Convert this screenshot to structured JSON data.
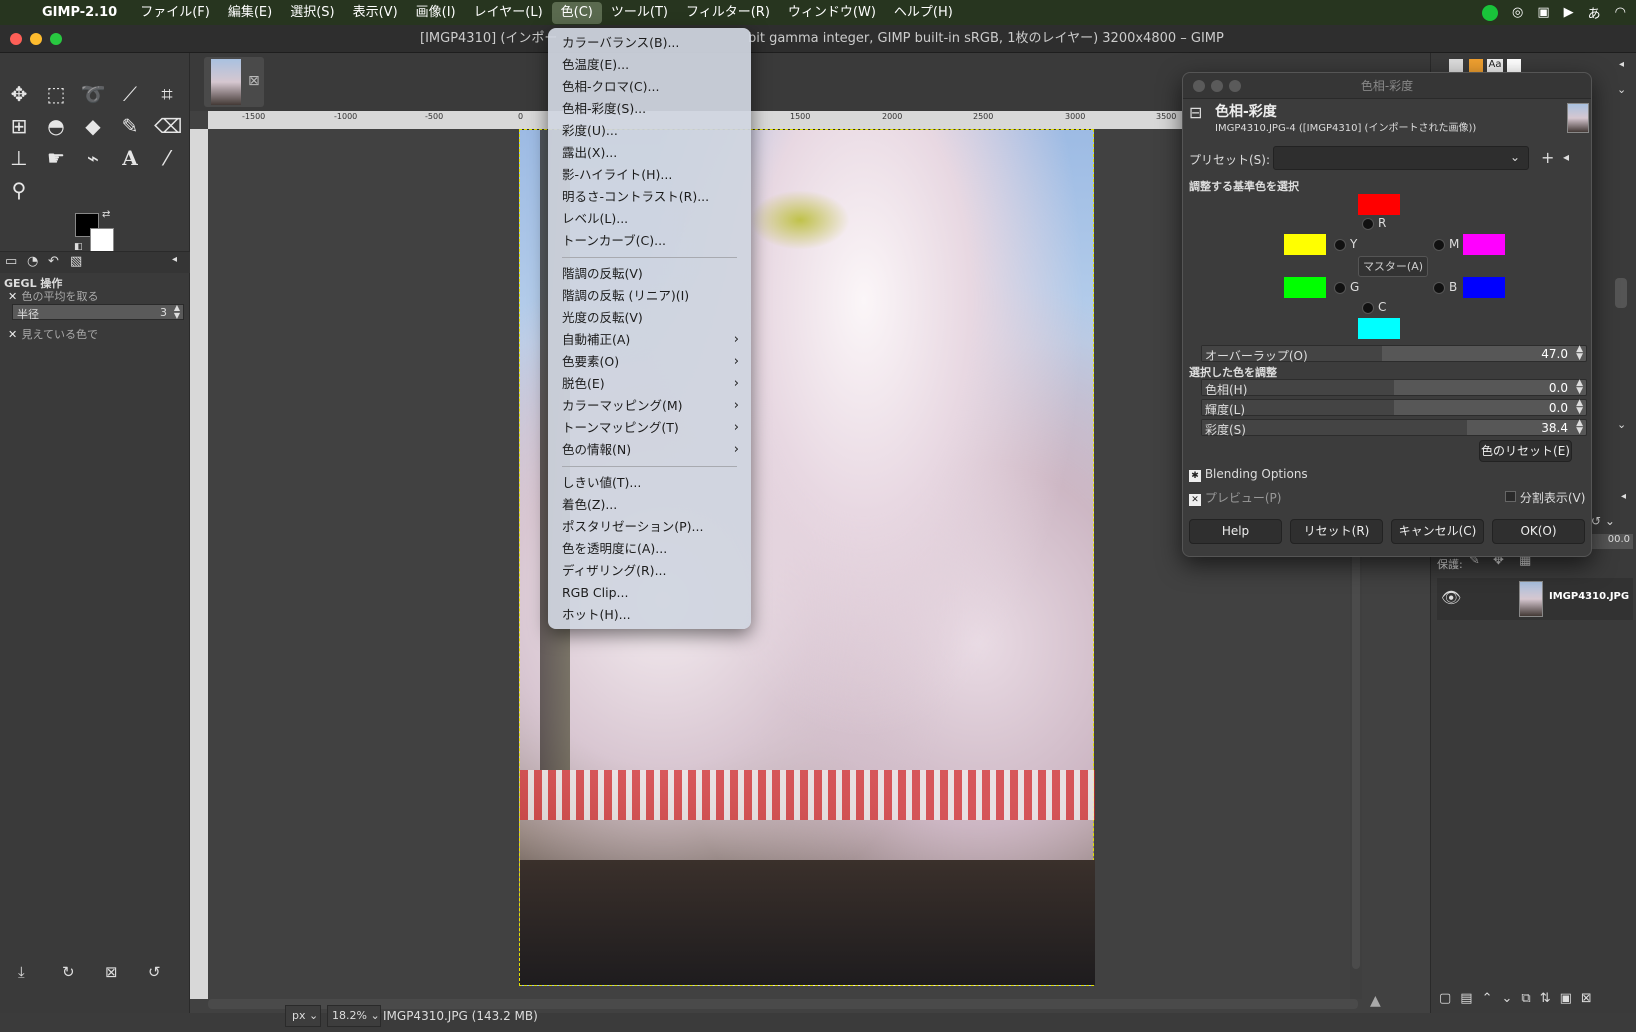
{
  "menubar": {
    "app": "GIMP-2.10",
    "items": [
      "ファイル(F)",
      "編集(E)",
      "選択(S)",
      "表示(V)",
      "画像(I)",
      "レイヤー(L)",
      "色(C)",
      "ツール(T)",
      "フィルター(R)",
      "ウィンドウ(W)",
      "ヘルプ(H)"
    ],
    "active_index": 6
  },
  "window": {
    "title_left": "[IMGP4310] (インポー",
    "title_right": "bit gamma integer, GIMP built-in sRGB, 1枚のレイヤー) 3200x4800 – GIMP"
  },
  "toolbox": {
    "dock_title": "GEGL 操作",
    "option1": "色の平均を取る",
    "radius_label": "半径",
    "radius_value": "3",
    "option2": "見えている色で"
  },
  "ruler": {
    "labels": [
      "-1500",
      "-1000",
      "-500",
      "0",
      "1500",
      "2000",
      "2500",
      "3000",
      "3500"
    ]
  },
  "status": {
    "unit": "px",
    "zoom": "18.2%",
    "file_info": "IMGP4310.JPG (143.2 MB)"
  },
  "color_menu": {
    "group1": [
      "カラーバランス(B)...",
      "色温度(E)...",
      "色相-クロマ(C)...",
      "色相-彩度(S)...",
      "彩度(U)...",
      "露出(X)...",
      "影-ハイライト(H)...",
      "明るさ-コントラスト(R)...",
      "レベル(L)...",
      "トーンカーブ(C)..."
    ],
    "group2": [
      "階調の反転(V)",
      "階調の反転 (リニア)(I)",
      "光度の反転(V)"
    ],
    "group2_sub": [
      "自動補正(A)",
      "色要素(O)",
      "脱色(E)",
      "カラーマッピング(M)",
      "トーンマッピング(T)",
      "色の情報(N)"
    ],
    "group3": [
      "しきい値(T)...",
      "着色(Z)...",
      "ポスタリゼーション(P)...",
      "色を透明度に(A)...",
      "ディザリング(R)...",
      "RGB Clip...",
      "ホット(H)..."
    ]
  },
  "dialog": {
    "window_title": "色相-彩度",
    "heading": "色相-彩度",
    "subheading": "IMGP4310.JPG-4 ([IMGP4310] (インポートされた画像))",
    "preset_label": "プリセット(S):",
    "primary_label": "調整する基準色を選択",
    "letters": {
      "r": "R",
      "y": "Y",
      "m": "M",
      "g": "G",
      "b": "B",
      "c": "C"
    },
    "master": "マスター(A)",
    "overlap_label": "オーバーラップ(O)",
    "overlap_value": "47.0",
    "overlap_fraction": 0.47,
    "adjust_label": "選択した色を調整",
    "hue_label": "色相(H)",
    "hue_value": "0.0",
    "lightness_label": "輝度(L)",
    "lightness_value": "0.0",
    "saturation_label": "彩度(S)",
    "saturation_value": "38.4",
    "reset_color": "色のリセット(E)",
    "blending": "Blending Options",
    "preview": "プレビュー(P)",
    "split": "分割表示(V)",
    "buttons": [
      "Help",
      "リセット(R)",
      "キャンセル(C)",
      "OK(O)"
    ],
    "colors": {
      "red": "#ff0000",
      "yellow": "#ffff00",
      "magenta": "#ff00ff",
      "green": "#00ff00",
      "blue": "#0000ff",
      "cyan": "#00ffff"
    }
  },
  "layers": {
    "protect_label": "保護:",
    "layer_name": "IMGP4310.JPG",
    "opacity_value": "00.0"
  }
}
